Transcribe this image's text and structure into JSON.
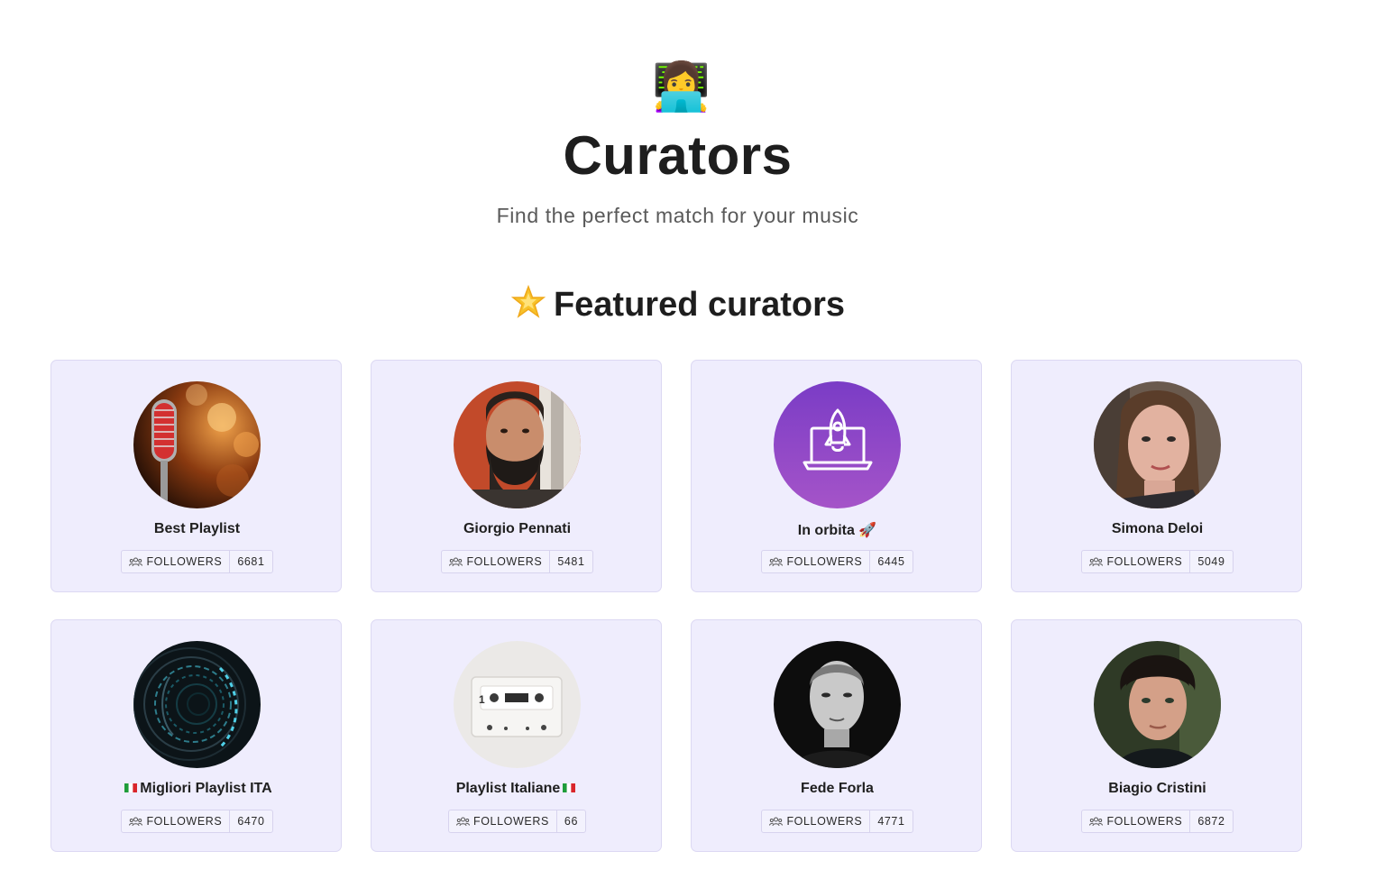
{
  "header": {
    "emoji": "👩‍💻",
    "title": "Curators",
    "subtitle": "Find the perfect match for your music"
  },
  "featured": {
    "title": "Featured curators",
    "icon": "glowing-star-icon"
  },
  "followers_label": "FOLLOWERS",
  "curators": [
    {
      "name": "Best Playlist",
      "followers": "6681",
      "avatar": "microphone-photo"
    },
    {
      "name": "Giorgio Pennati",
      "followers": "5481",
      "avatar": "bearded-man-photo"
    },
    {
      "name": "In orbita 🚀",
      "followers": "6445",
      "avatar": "rocket-laptop-logo"
    },
    {
      "name": "Simona Deloi",
      "followers": "5049",
      "avatar": "woman-portrait-photo"
    },
    {
      "name": "Migliori Playlist ITA",
      "followers": "6470",
      "avatar": "spiral-tunnel-photo"
    },
    {
      "name": "Playlist Italiane",
      "followers": "66",
      "avatar": "cassette-tape-photo"
    },
    {
      "name": "Fede Forla",
      "followers": "4771",
      "avatar": "bw-man-portrait-photo"
    },
    {
      "name": "Biagio Cristini",
      "followers": "6872",
      "avatar": "young-man-portrait-photo"
    }
  ],
  "colors": {
    "card_bg": "#efedfd",
    "card_border": "#dcd8f3",
    "title": "#1e1e1e",
    "subtitle": "#5a5a5a",
    "orbita_purple": "#8a3fc8"
  }
}
